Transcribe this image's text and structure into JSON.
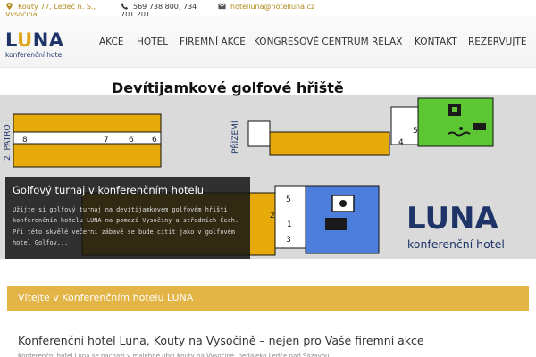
{
  "topbar": {
    "address": "Kouty 77, Ledeč n. S., Vysočina",
    "phone": "569 738 800, 734 701 201",
    "email": "hotelluna@hotelluna.cz"
  },
  "header": {
    "logo_word_pre": "L",
    "logo_word_u": "U",
    "logo_word_post": "NA",
    "logo_sub": "konferenční hotel"
  },
  "nav": {
    "items": [
      "AKCE",
      "HOTEL",
      "FIREMNÍ AKCE",
      "KONGRESOVÉ CENTRUM",
      "RELAX",
      "KONTAKT",
      "REZERVUJTE"
    ]
  },
  "slide": {
    "banner_title": "Devítijamkové golfové hřiště",
    "floor_2": "2. PATRO",
    "floor_0": "PŘÍZEMÍ",
    "holes_upper": [
      "8",
      "7",
      "6"
    ],
    "holes_ground": [
      "5",
      "4",
      "3",
      "2"
    ],
    "hole_labels": {
      "h1": "1",
      "h5": "5"
    },
    "logo_word": "LUNA",
    "logo_sub": "konferenční hotel",
    "colors": {
      "gold": "#e6ab0a",
      "green": "#5cc733",
      "blue": "#4d7edb",
      "navy": "#1e3468"
    }
  },
  "caption": {
    "title": "Golfový turnaj v konferenčním hotelu",
    "text": "Užijte si golfový turnaj na devítijamkovém golfovém hřišti konferenčním hotelu LUNA na pomezí Vysočiny a středních Čech. Při této skvělé večerní zábavě se bude cítit jako v golfovém hotel Golfov..."
  },
  "slider": {
    "dot_count": 4,
    "active_dot": 1
  },
  "welcome": {
    "text": "Vítejte v Konferenčním hotelu LUNA"
  },
  "content": {
    "title": "Konferenční hotel Luna, Kouty na Vysočině – nejen pro Vaše firemní akce",
    "intro": "Konferenční hotel Luna se nachází v malebné obci Kouty na Vysočině, nedaleko Ledče nad Sázavou"
  }
}
